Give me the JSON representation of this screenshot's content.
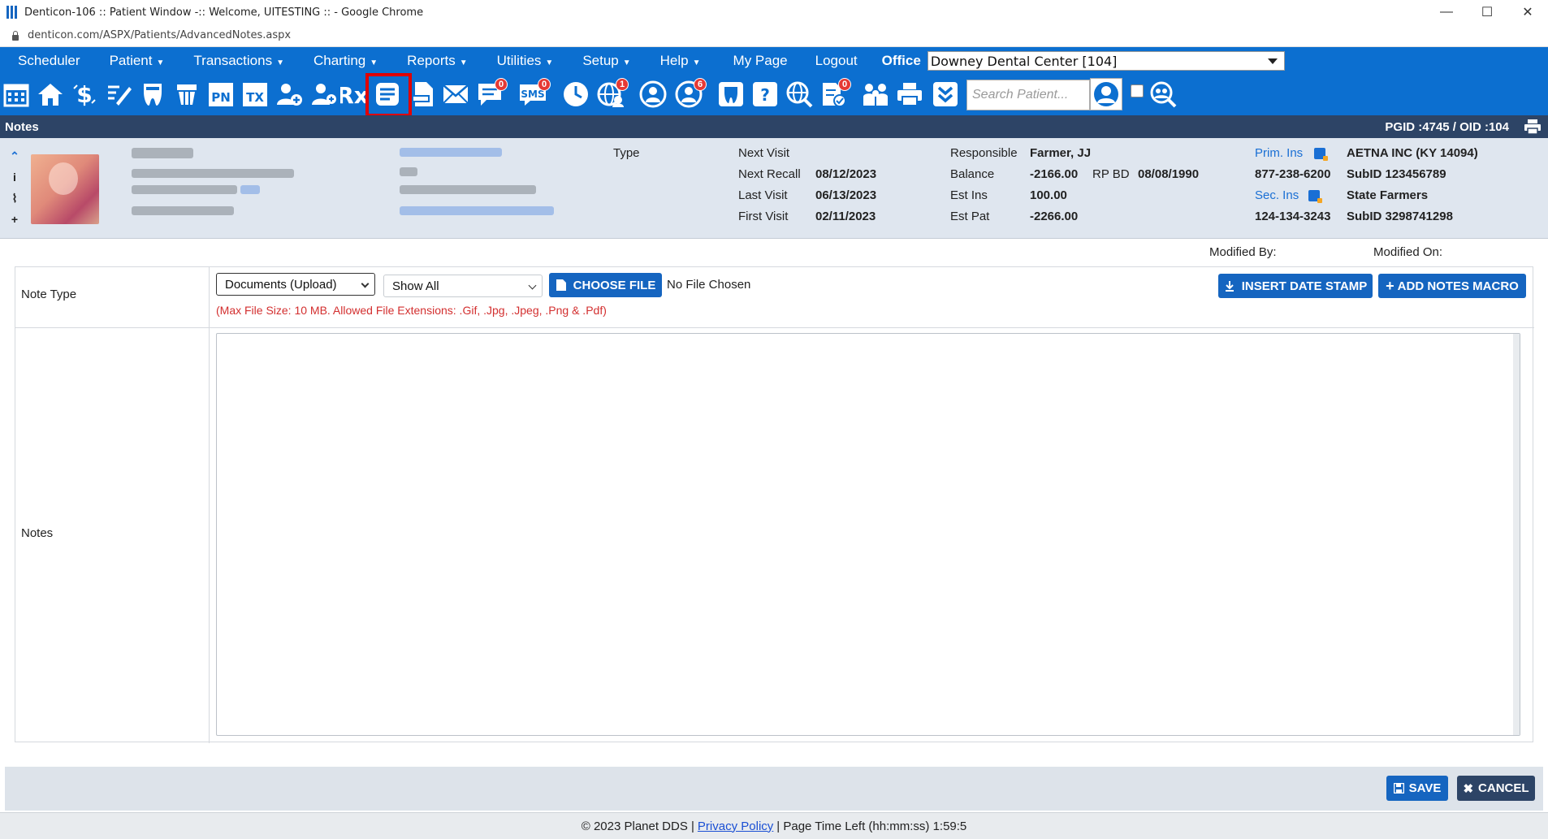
{
  "window": {
    "title": "Denticon-106 :: Patient Window -:: Welcome, UITESTING :: - Google Chrome",
    "url": "denticon.com/ASPX/Patients/AdvancedNotes.aspx",
    "minimize": "—",
    "maximize": "☐",
    "close": "✕"
  },
  "menu": {
    "items": [
      {
        "label": "Scheduler",
        "caret": ""
      },
      {
        "label": "Patient",
        "caret": "▼"
      },
      {
        "label": "Transactions",
        "caret": "▼"
      },
      {
        "label": "Charting",
        "caret": "▼"
      },
      {
        "label": "Reports",
        "caret": "▼"
      },
      {
        "label": "Utilities",
        "caret": "▼"
      },
      {
        "label": "Setup",
        "caret": "▼"
      },
      {
        "label": "Help",
        "caret": "▼"
      },
      {
        "label": "My Page",
        "caret": ""
      },
      {
        "label": "Logout",
        "caret": ""
      }
    ],
    "office_label": "Office",
    "office_value": "Downey Dental Center [104]"
  },
  "toolbar": {
    "badges": {
      "messages": "0",
      "sms": "0",
      "web": "1",
      "portal": "6",
      "forms": "0"
    },
    "tx_label": "TX",
    "pn_label": "PN",
    "rx_label": "Rx",
    "sms_label": "SMS",
    "search_placeholder": "Search Patient..."
  },
  "section": {
    "title": "Notes",
    "ids": "PGID :4745  /  OID :104"
  },
  "patient": {
    "type_label": "Type",
    "next_visit_label": "Next Visit",
    "next_visit": "",
    "next_recall_label": "Next Recall",
    "next_recall": "08/12/2023",
    "last_visit_label": "Last Visit",
    "last_visit": "06/13/2023",
    "first_visit_label": "First Visit",
    "first_visit": "02/11/2023",
    "responsible_label": "Responsible",
    "responsible": "Farmer, JJ",
    "balance_label": "Balance",
    "balance": "-2166.00",
    "rpbd_label": "RP BD",
    "rpbd": "08/08/1990",
    "est_ins_label": "Est Ins",
    "est_ins": "100.00",
    "est_pat_label": "Est Pat",
    "est_pat": "-2266.00",
    "prim_ins_label": "Prim. Ins",
    "prim_ins": "AETNA INC (KY 14094)",
    "prim_phone": "877-238-6200",
    "prim_subid": "SubID 123456789",
    "sec_ins_label": "Sec. Ins",
    "sec_ins": "State Farmers",
    "sec_phone": "124-134-3243",
    "sec_subid": "SubID 3298741298"
  },
  "form": {
    "modified_by_label": "Modified By:",
    "modified_on_label": "Modified On:",
    "note_type_label": "Note Type",
    "note_type_value": "Documents (Upload)",
    "filter_value": "Show All",
    "choose_file": "CHOOSE FILE",
    "no_file": "No File Chosen",
    "hint": "(Max File Size: 10 MB. Allowed File Extensions: .Gif, .Jpg, .Jpeg, .Png & .Pdf)",
    "insert_date_stamp": "INSERT DATE STAMP",
    "add_notes_macro": "ADD NOTES MACRO",
    "notes_label": "Notes",
    "notes_value": ""
  },
  "actions": {
    "save": "SAVE",
    "cancel": "CANCEL"
  },
  "footer": {
    "copyright": "© 2023 Planet DDS |",
    "privacy": "Privacy Policy",
    "time_left": "| Page Time Left (hh:mm:ss) 1:59:5"
  }
}
